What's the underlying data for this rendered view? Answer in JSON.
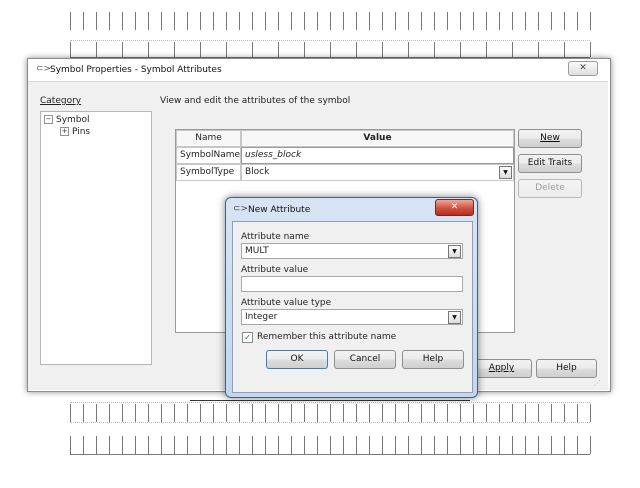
{
  "main_dialog": {
    "title": "Symbol Properties - Symbol Attributes",
    "close_glyph": "✕",
    "category_label": "Category",
    "description": "View and edit the attributes of the symbol",
    "tree": [
      {
        "label": "Symbol",
        "toggle": "−"
      },
      {
        "label": "Pins",
        "toggle": "+"
      }
    ],
    "grid": {
      "columns": [
        "Name",
        "Value"
      ],
      "rows": [
        {
          "name": "SymbolName",
          "value": "usless_block"
        },
        {
          "name": "SymbolType",
          "value": "Block"
        }
      ]
    },
    "buttons": {
      "new": "New",
      "edit_traits": "Edit Traits",
      "delete": "Delete",
      "apply": "Apply",
      "help": "Help"
    }
  },
  "new_attribute_dialog": {
    "title": "New Attribute",
    "close_glyph": "✕",
    "name_label": "Attribute name",
    "name_value": "MULT",
    "value_label": "Attribute value",
    "value_value": "",
    "type_label": "Attribute value type",
    "type_value": "Integer",
    "remember_label": "Remember this attribute name",
    "remember_checked": true,
    "buttons": {
      "ok": "OK",
      "cancel": "Cancel",
      "help": "Help"
    }
  },
  "icons": {
    "app": "cadence-icon",
    "dropdown": "chevron-down-icon"
  },
  "colors": {
    "accent": "#3c7fb1",
    "close_red": "#c8402e",
    "dialog_frame": "#c2d6ee"
  }
}
